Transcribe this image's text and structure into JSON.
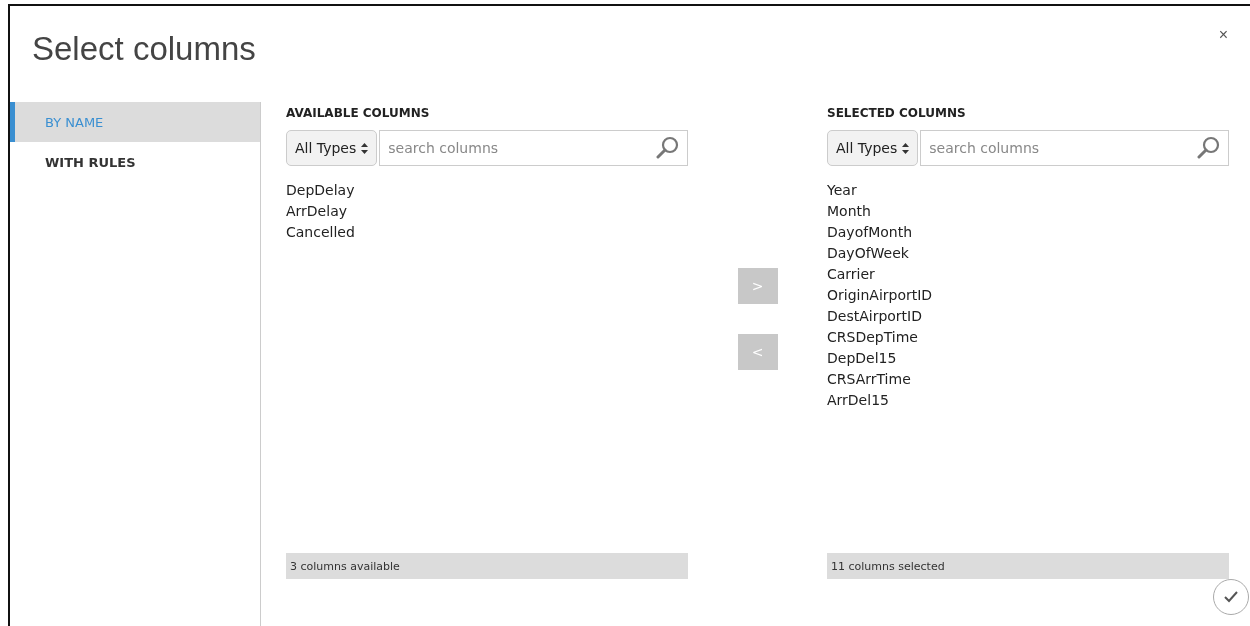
{
  "dialog": {
    "title": "Select columns",
    "close": "×"
  },
  "sidebar": {
    "items": [
      {
        "label": "BY NAME",
        "selected": true
      },
      {
        "label": "WITH RULES",
        "selected": false
      }
    ]
  },
  "panels": [
    {
      "heading": "AVAILABLE COLUMNS",
      "type_filter": "All Types",
      "placeholder": "search columns",
      "items": [
        "DepDelay",
        "ArrDelay",
        "Cancelled"
      ],
      "footer": "3 columns available"
    },
    {
      "heading": "SELECTED COLUMNS",
      "type_filter": "All Types",
      "placeholder": "search columns",
      "items": [
        "Year",
        "Month",
        "DayofMonth",
        "DayOfWeek",
        "Carrier",
        "OriginAirportID",
        "DestAirportID",
        "CRSDepTime",
        "DepDel15",
        "CRSArrTime",
        "ArrDel15"
      ],
      "footer": "11 columns selected"
    }
  ],
  "move_buttons": [
    ">",
    "<"
  ]
}
